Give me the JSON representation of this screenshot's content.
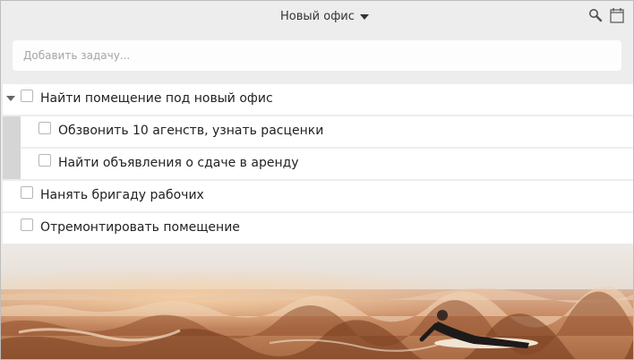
{
  "header": {
    "title": "Новый офис",
    "icons": [
      "search-icon",
      "calendar-icon",
      "chevron-down-icon"
    ]
  },
  "add_task": {
    "placeholder": "Добавить задачу..."
  },
  "tasks": [
    {
      "label": "Найти помещение под новый офис",
      "checked": false,
      "expanded": true,
      "subtasks": [
        {
          "label": "Обзвонить 10 агенств, узнать расценки",
          "checked": false
        },
        {
          "label": "Найти объявления о сдаче в аренду",
          "checked": false
        }
      ]
    },
    {
      "label": "Нанять бригаду рабочих",
      "checked": false
    },
    {
      "label": "Отремонтировать помещение",
      "checked": false
    }
  ],
  "colors": {
    "background": "#ededed",
    "row": "#ffffff",
    "subtask_indent_bar": "#d5d5d5",
    "text": "#222222",
    "placeholder": "#a5a5a5"
  }
}
